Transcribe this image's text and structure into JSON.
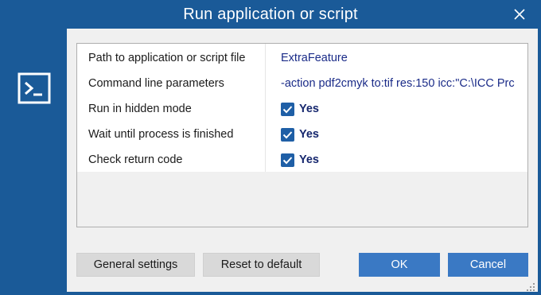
{
  "window": {
    "title": "Run application or script",
    "accent": "#1a5a98"
  },
  "properties": [
    {
      "label": "Path to application or script file",
      "value": "ExtraFeature"
    },
    {
      "label": "Command line parameters",
      "value": "-action pdf2cmyk to:tif res:150 icc:\"C:\\ICC Prc"
    },
    {
      "label": "Run in hidden mode",
      "checked": true,
      "value": "Yes"
    },
    {
      "label": "Wait until process is finished",
      "checked": true,
      "value": "Yes"
    },
    {
      "label": "Check return code",
      "checked": true,
      "value": "Yes"
    }
  ],
  "buttons": {
    "general_settings": "General settings",
    "reset_to_default": "Reset to default",
    "ok": "OK",
    "cancel": "Cancel"
  },
  "icons": {
    "close": "close-icon",
    "app": "terminal-icon",
    "check": "checkmark-icon",
    "grip": "resize-grip-icon"
  }
}
